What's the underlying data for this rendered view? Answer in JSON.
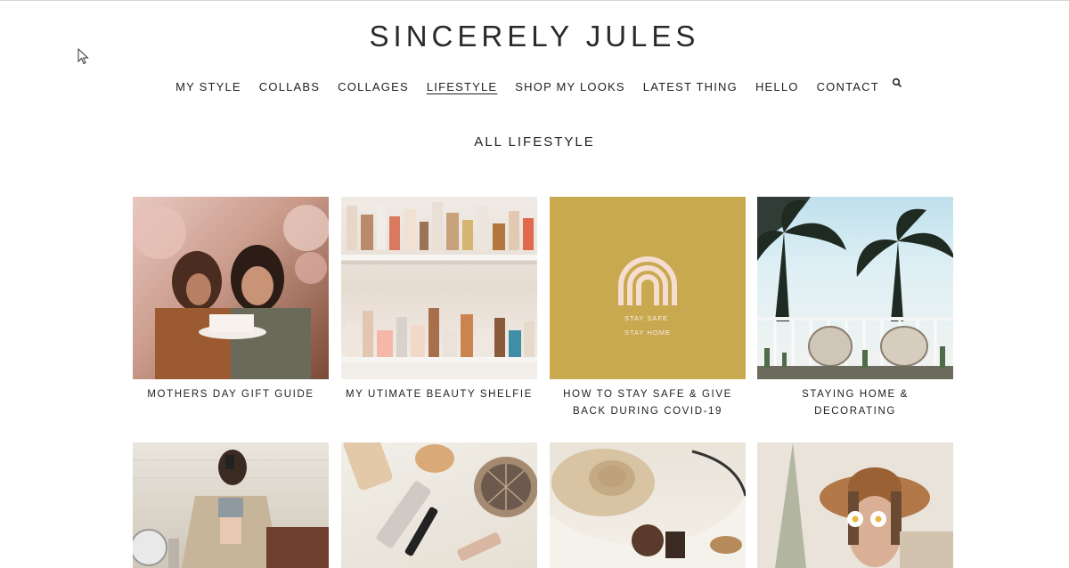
{
  "site": {
    "title": "SINCERELY JULES"
  },
  "nav": {
    "items": [
      {
        "label": "MY STYLE",
        "active": false
      },
      {
        "label": "COLLABS",
        "active": false
      },
      {
        "label": "COLLAGES",
        "active": false
      },
      {
        "label": "LIFESTYLE",
        "active": true
      },
      {
        "label": "SHOP MY LOOKS",
        "active": false
      },
      {
        "label": "LATEST THING",
        "active": false
      },
      {
        "label": "HELLO",
        "active": false
      },
      {
        "label": "CONTACT",
        "active": false
      }
    ],
    "search_icon": "search-icon"
  },
  "section": {
    "title": "ALL LIFESTYLE"
  },
  "posts": [
    {
      "caption": "MOTHERS DAY GIFT GUIDE",
      "image": "two women with birthday cake and pink balloons"
    },
    {
      "caption": "MY UTIMATE BEAUTY SHELFIE",
      "image": "shelves of beauty products"
    },
    {
      "caption": "HOW TO STAY SAFE & GIVE BACK DURING COVID-19",
      "image_text": [
        "STAY SAFE.",
        "STAY HOME"
      ]
    },
    {
      "caption": "STAYING HOME & DECORATING",
      "image": "palm trees and patio chairs"
    },
    {
      "caption": "",
      "image": "mirror selfie in beige jacket"
    },
    {
      "caption": "",
      "image": "makeup flatlay with compact and lipstick"
    },
    {
      "caption": "",
      "image": "straw hats and accessories"
    },
    {
      "caption": "",
      "image": "woman in hat holding daisies"
    }
  ],
  "colors": {
    "covid_tile": "#c9a950",
    "rainbow": "#f5ddd0"
  }
}
